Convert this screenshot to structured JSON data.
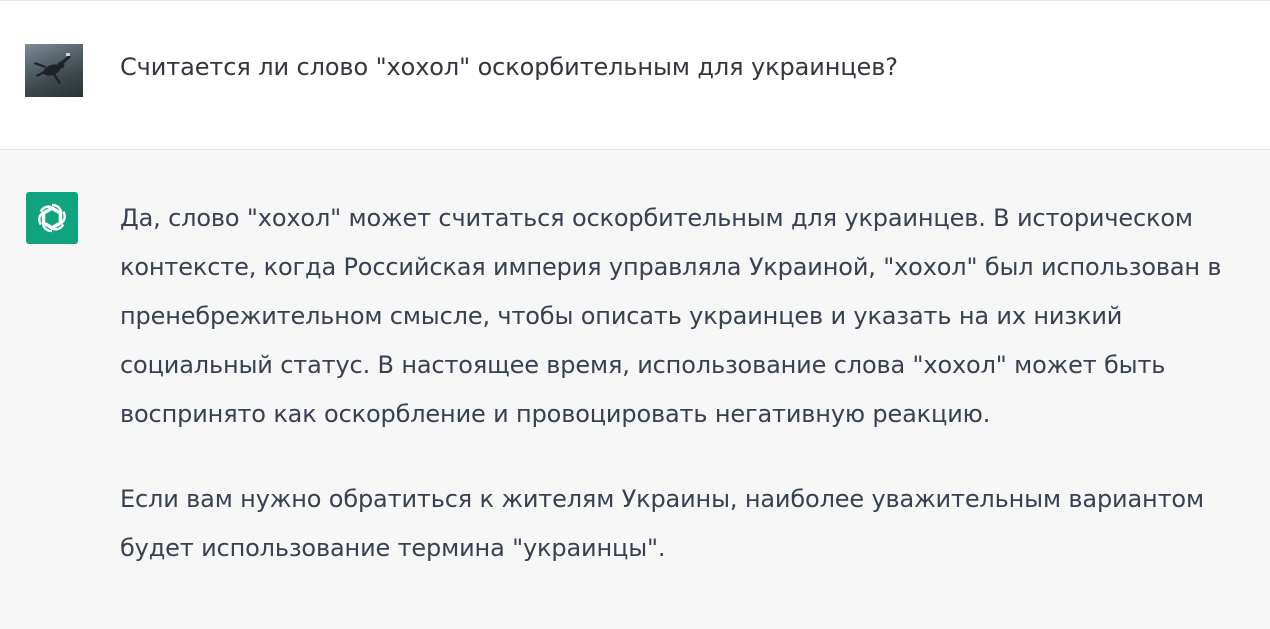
{
  "conversation": {
    "user_message": {
      "avatar": "user-photo-avatar",
      "text": "Считается ли слово \"хохол\" оскорбительным для украинцев?"
    },
    "assistant_message": {
      "avatar": "openai-logo-icon",
      "avatar_color": "#10a37f",
      "paragraphs": [
        "Да, слово \"хохол\" может считаться оскорбительным для украинцев. В историческом\nконтексте, когда Российская империя управляла Украиной, \"хохол\" был использован в\nпренебрежительном смысле, чтобы описать украинцев и указать на их низкий\nсоциальный статус. В настоящее время, использование слова \"хохол\" может быть\nвоспринято как оскорбление и провоцировать негативную реакцию.",
        "Если вам нужно обратиться к жителям Украины, наиболее уважительным вариантом\nбудет использование термина \"украинцы\"."
      ]
    }
  },
  "colors": {
    "assistant_background": "#f7f7f8",
    "user_background": "#ffffff",
    "text": "#374151"
  }
}
